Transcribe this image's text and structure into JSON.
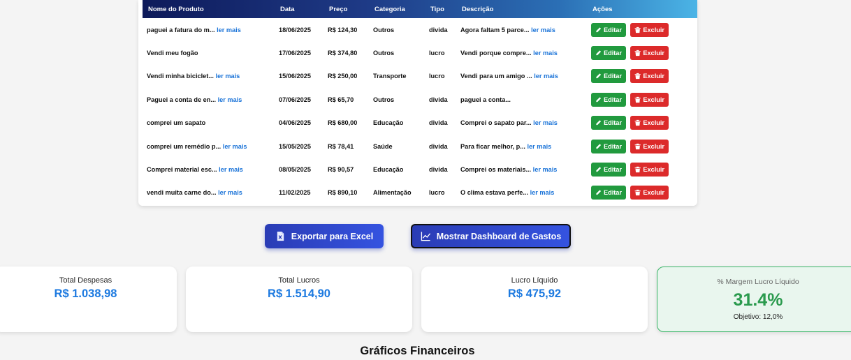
{
  "table": {
    "headers": [
      "Nome do Produto",
      "Data",
      "Preço",
      "Categoria",
      "Tipo",
      "Descrição",
      "Ações"
    ],
    "read_more_label": "ler mais",
    "edit_label": "Editar",
    "delete_label": "Excluir",
    "rows": [
      {
        "name": "paguei a fatura do m...",
        "name_more": true,
        "date": "18/06/2025",
        "price": "R$ 124,30",
        "category": "Outros",
        "type": "divida",
        "desc": "Agora faltam 5 parce...",
        "desc_more": true
      },
      {
        "name": "Vendi meu fogão",
        "name_more": false,
        "date": "17/06/2025",
        "price": "R$ 374,80",
        "category": "Outros",
        "type": "lucro",
        "desc": "Vendi porque compre...",
        "desc_more": true
      },
      {
        "name": "Vendi minha biciclet...",
        "name_more": true,
        "date": "15/06/2025",
        "price": "R$ 250,00",
        "category": "Transporte",
        "type": "lucro",
        "desc": "Vendi para um amigo ...",
        "desc_more": true
      },
      {
        "name": "Paguei a conta de en...",
        "name_more": true,
        "date": "07/06/2025",
        "price": "R$ 65,70",
        "category": "Outros",
        "type": "divida",
        "desc": "paguei a conta...",
        "desc_more": false
      },
      {
        "name": "comprei um sapato",
        "name_more": false,
        "date": "04/06/2025",
        "price": "R$ 680,00",
        "category": "Educação",
        "type": "divida",
        "desc": "Comprei o sapato par...",
        "desc_more": true
      },
      {
        "name": "comprei um remédio p...",
        "name_more": true,
        "date": "15/05/2025",
        "price": "R$ 78,41",
        "category": "Saúde",
        "type": "divida",
        "desc": "Para ficar melhor, p...",
        "desc_more": true
      },
      {
        "name": "Comprei material esc...",
        "name_more": true,
        "date": "08/05/2025",
        "price": "R$ 90,57",
        "category": "Educação",
        "type": "divida",
        "desc": "Comprei os materiais...",
        "desc_more": true
      },
      {
        "name": "vendi muita carne do...",
        "name_more": true,
        "date": "11/02/2025",
        "price": "R$ 890,10",
        "category": "Alimentação",
        "type": "lucro",
        "desc": "O clima estava perfe...",
        "desc_more": true
      }
    ]
  },
  "buttons": {
    "export": "Exportar para Excel",
    "dashboard": "Mostrar Dashboard de Gastos"
  },
  "stats": {
    "expenses_label": "Total Despesas",
    "expenses_value": "R$ 1.038,98",
    "profits_label": "Total Lucros",
    "profits_value": "R$ 1.514,90",
    "net_label": "Lucro Líquido",
    "net_value": "R$ 475,92",
    "margin_label": "% Margem Lucro Líquido",
    "margin_value": "31.4%",
    "margin_goal": "Objetivo: 12,0%"
  },
  "charts_title": "Gráficos Financeiros",
  "colors": {
    "accent_blue": "#1d7ae0",
    "edit_green": "#219a3e",
    "delete_red": "#dc2a2a",
    "margin_green": "#2a9a4d"
  }
}
